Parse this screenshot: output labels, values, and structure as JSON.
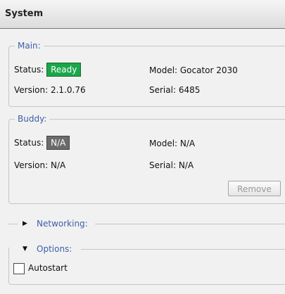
{
  "header": {
    "title": "System"
  },
  "main": {
    "legend": "Main:",
    "status_label": "Status:",
    "status_value": "Ready",
    "model": "Model: Gocator 2030",
    "version": "Version: 2.1.0.76",
    "serial": "Serial: 6485"
  },
  "buddy": {
    "legend": "Buddy:",
    "status_label": "Status:",
    "status_value": "N/A",
    "model": "Model: N/A",
    "version": "Version: N/A",
    "serial": "Serial: N/A",
    "remove_label": "Remove"
  },
  "networking": {
    "label": "Networking:",
    "expanded": false
  },
  "options": {
    "label": "Options:",
    "expanded": true,
    "autostart_label": "Autostart",
    "autostart_checked": false
  },
  "colors": {
    "ready_badge": "#1aa64b",
    "na_badge": "#6b6b6b",
    "section_label": "#3c5fa8"
  },
  "icons": {
    "collapsed": "triangle-right",
    "expanded": "triangle-down"
  }
}
